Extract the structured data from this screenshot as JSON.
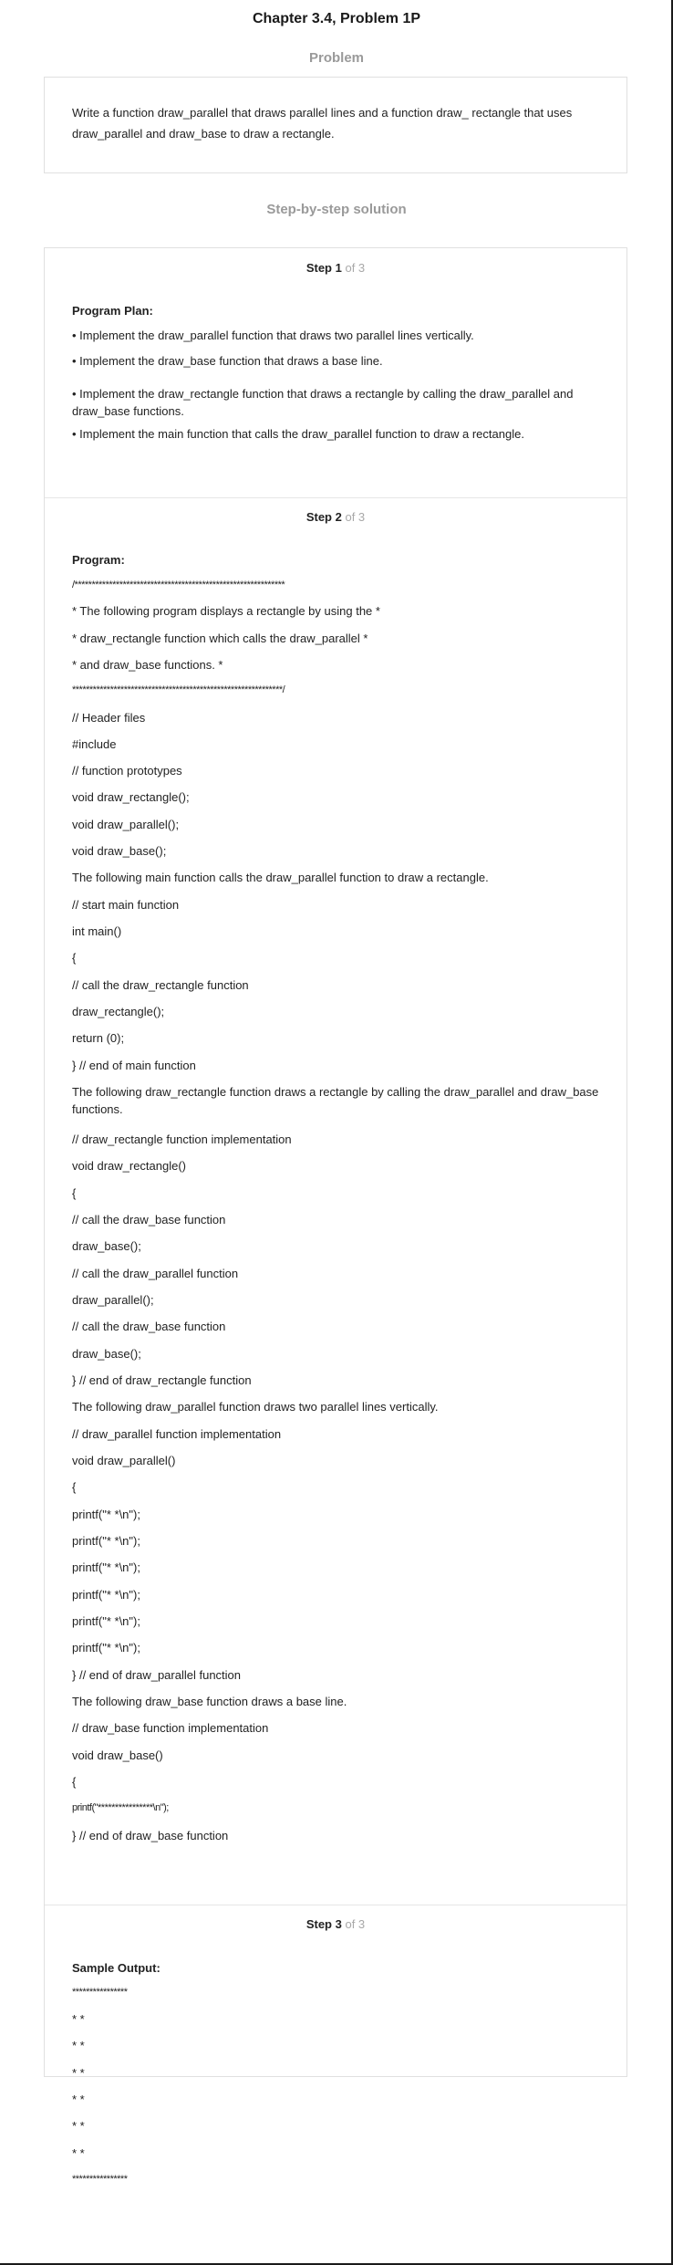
{
  "page": {
    "title": "Chapter 3.4, Problem 1P"
  },
  "problem": {
    "heading": "Problem",
    "text": "Write a function draw_parallel that draws parallel lines and a function draw_ rectangle that uses draw_parallel and draw_base to draw a rectangle."
  },
  "solution": {
    "heading": "Step-by-step solution",
    "of_total": "of 3",
    "steps": [
      {
        "word": "Step 1",
        "lines": [
          "Program Plan:",
          "• Implement the draw_parallel function that draws two parallel lines vertically.",
          "• Implement the draw_base function that draws a base line.",
          "• Implement the draw_rectangle function that draws a rectangle by calling the draw_parallel and draw_base functions.",
          "• Implement the main function that calls the draw_parallel function to draw a rectangle."
        ]
      },
      {
        "word": "Step 2",
        "lines": [
          "Program:",
          "/*************************************************************",
          "* The following program displays a rectangle by using the *",
          "* draw_rectangle function which calls the draw_parallel *",
          "* and draw_base functions. *",
          "*************************************************************/",
          "// Header files",
          "#include",
          "// function prototypes",
          "void draw_rectangle();",
          "void draw_parallel();",
          "void draw_base();",
          "The following main function calls the draw_parallel function to draw a rectangle.",
          "// start main function",
          "int main()",
          "{",
          "// call the draw_rectangle function",
          "draw_rectangle();",
          "return (0);",
          "} // end of main function",
          "The following draw_rectangle function draws a rectangle by calling the draw_parallel and draw_base functions.",
          "// draw_rectangle function implementation",
          "void draw_rectangle()",
          "{",
          "// call the draw_base function",
          "draw_base();",
          "// call the draw_parallel function",
          "draw_parallel();",
          "// call the draw_base function",
          "draw_base();",
          "} // end of draw_rectangle function",
          "The following draw_parallel function draws two parallel lines vertically.",
          "// draw_parallel function implementation",
          "void draw_parallel()",
          "{",
          "printf(\"* *\\n\");",
          "printf(\"* *\\n\");",
          "printf(\"* *\\n\");",
          "printf(\"* *\\n\");",
          "printf(\"* *\\n\");",
          "printf(\"* *\\n\");",
          "} // end of draw_parallel function",
          "The following draw_base function draws a base line.",
          "// draw_base function implementation",
          "void draw_base()",
          "{",
          "printf(\"****************\\n\");",
          "} // end of draw_base function"
        ]
      },
      {
        "word": "Step 3",
        "lines": [
          "Sample Output:",
          "****************",
          "* *",
          "* *",
          "* *",
          "* *",
          "* *",
          "* *",
          "****************"
        ]
      }
    ]
  }
}
